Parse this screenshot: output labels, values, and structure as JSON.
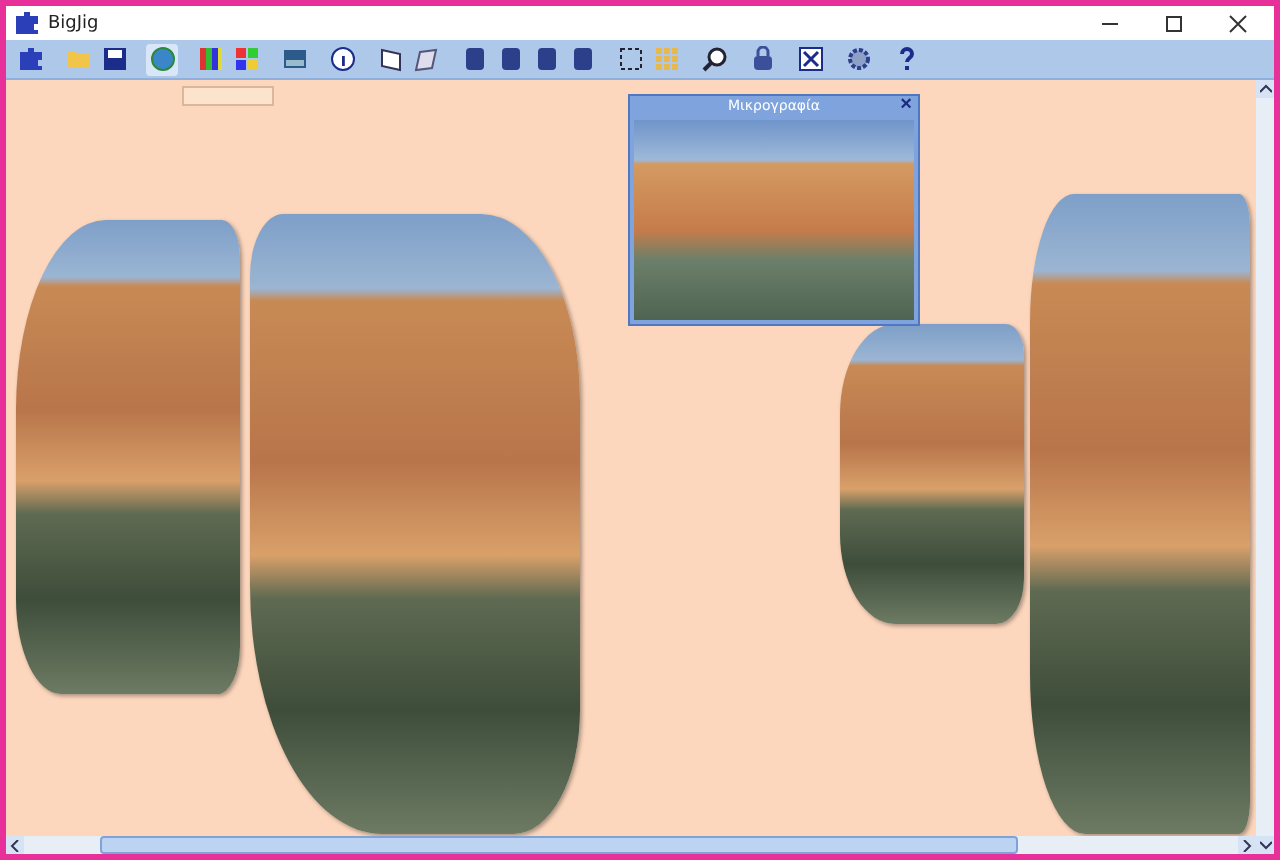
{
  "window": {
    "title": "BigJig"
  },
  "thumbnail": {
    "title": "Μικρογραφία",
    "close": "×"
  }
}
